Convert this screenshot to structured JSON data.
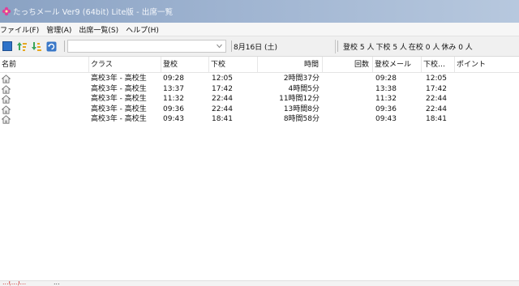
{
  "window": {
    "title": "たっちメール Ver9 (64bit) Lite版 - 出席一覧"
  },
  "menu": [
    "ファイル(F)",
    "管理(A)",
    "出席一覧(S)",
    "ヘルプ(H)"
  ],
  "toolbar": {
    "combo_value": "",
    "date": "8月16日 (土)",
    "status": [
      "登校 5 人",
      "下校 5 人",
      "在校 0 人",
      "休み 0 人"
    ]
  },
  "table": {
    "headers": [
      "名前",
      "クラス",
      "登校",
      "下校",
      "時間",
      "回数",
      "登校メール",
      "下校…",
      "ポイント"
    ],
    "rows": [
      {
        "name": "",
        "class": "高校3年 - 高校生",
        "in": "09:28",
        "out": "12:05",
        "duration": "2時間37分",
        "count": "",
        "in_mail": "09:28",
        "out_mail": "12:05",
        "points": ""
      },
      {
        "name": "",
        "class": "高校3年 - 高校生",
        "in": "13:37",
        "out": "17:42",
        "duration": "4時間5分",
        "count": "",
        "in_mail": "13:38",
        "out_mail": "17:42",
        "points": ""
      },
      {
        "name": "",
        "class": "高校3年 - 高校生",
        "in": "11:32",
        "out": "22:44",
        "duration": "11時間12分",
        "count": "",
        "in_mail": "11:32",
        "out_mail": "22:44",
        "points": ""
      },
      {
        "name": "",
        "class": "高校3年 - 高校生",
        "in": "09:36",
        "out": "22:44",
        "duration": "13時間8分",
        "count": "",
        "in_mail": "09:36",
        "out_mail": "22:44",
        "points": ""
      },
      {
        "name": "",
        "class": "高校3年 - 高校生",
        "in": "09:43",
        "out": "18:41",
        "duration": "8時間58分",
        "count": "",
        "in_mail": "09:43",
        "out_mail": "18:41",
        "points": ""
      }
    ]
  },
  "statusbar": {
    "left": "...(...)...",
    "right": "..."
  },
  "colors": {
    "titlebar": "#9fb4d1",
    "accent_red": "#cc2222"
  },
  "icons": [
    "app-flower-icon",
    "stop-icon",
    "sort-up-icon",
    "sort-down-icon",
    "refresh-icon",
    "house-icon"
  ]
}
